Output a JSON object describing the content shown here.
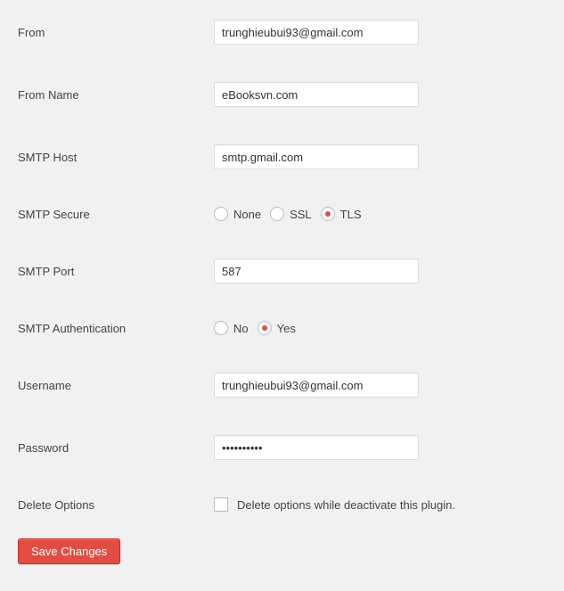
{
  "form": {
    "from": {
      "label": "From",
      "value": "trunghieubui93@gmail.com"
    },
    "from_name": {
      "label": "From Name",
      "value": "eBooksvn.com"
    },
    "smtp_host": {
      "label": "SMTP Host",
      "value": "smtp.gmail.com"
    },
    "smtp_secure": {
      "label": "SMTP Secure",
      "options": [
        {
          "label": "None",
          "checked": false
        },
        {
          "label": "SSL",
          "checked": false
        },
        {
          "label": "TLS",
          "checked": true
        }
      ]
    },
    "smtp_port": {
      "label": "SMTP Port",
      "value": "587"
    },
    "smtp_auth": {
      "label": "SMTP Authentication",
      "options": [
        {
          "label": "No",
          "checked": false
        },
        {
          "label": "Yes",
          "checked": true
        }
      ]
    },
    "username": {
      "label": "Username",
      "value": "trunghieubui93@gmail.com"
    },
    "password": {
      "label": "Password",
      "value": "••••••••••"
    },
    "delete_options": {
      "label": "Delete Options",
      "checkbox_label": "Delete options while deactivate this plugin.",
      "checked": false
    },
    "submit_label": "Save Changes"
  }
}
